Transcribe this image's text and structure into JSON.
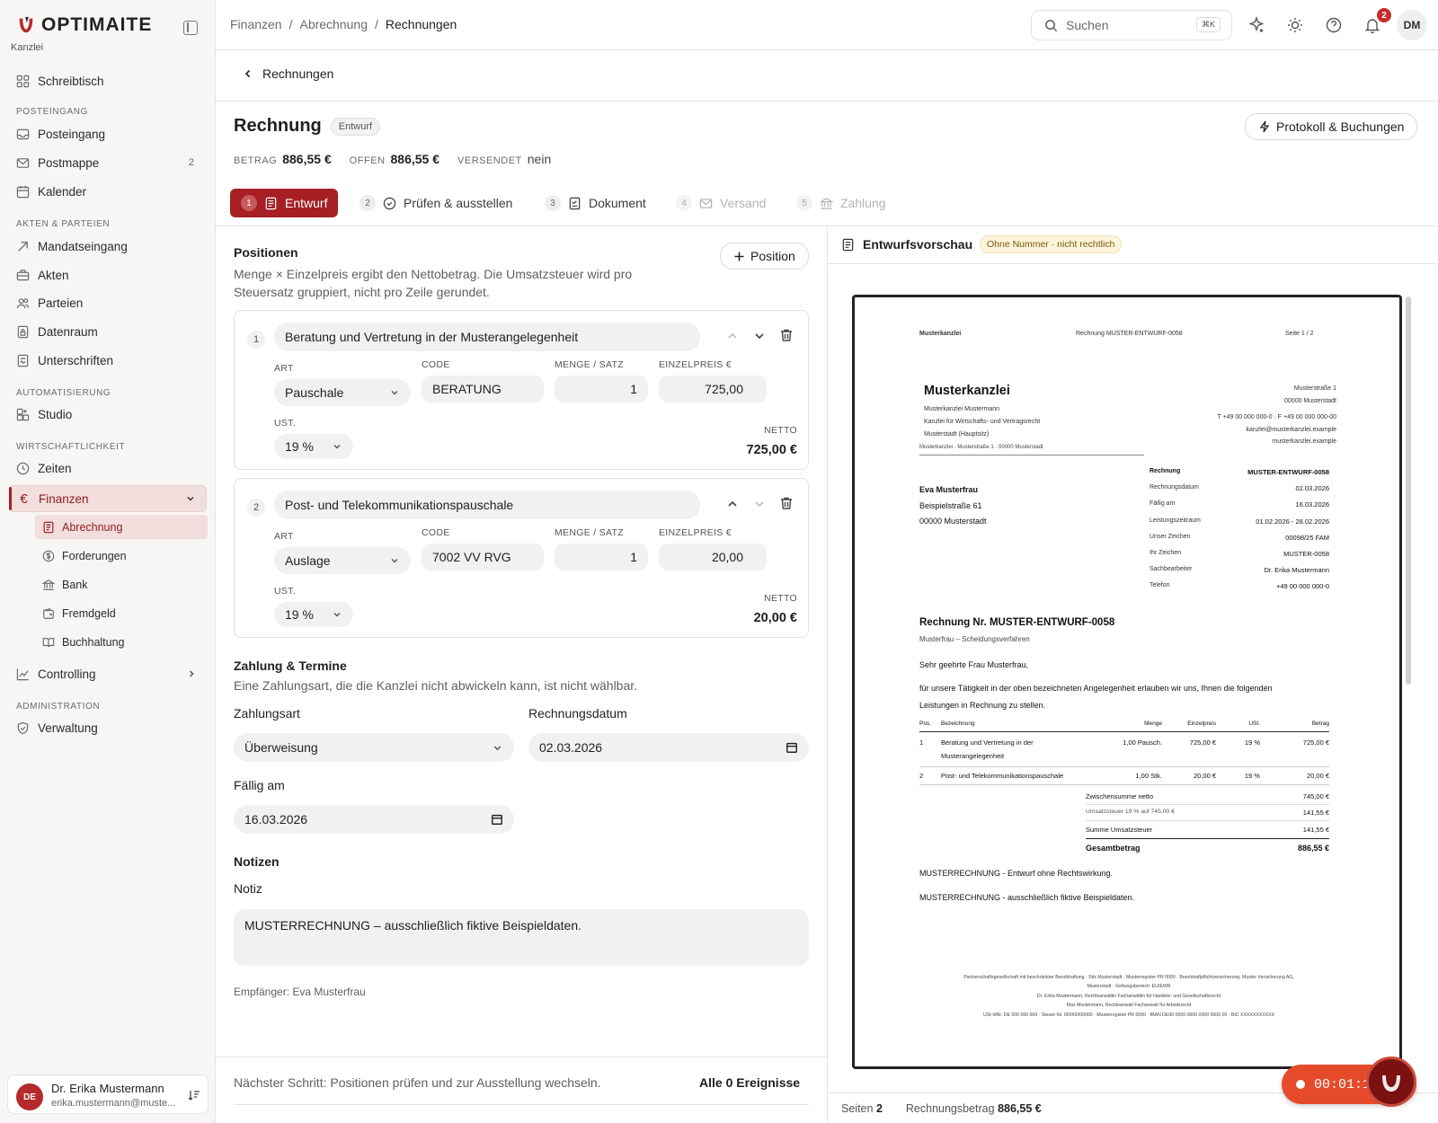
{
  "app": {
    "logo": "OPTIMAITE",
    "workspace": "Kanzlei"
  },
  "sidebar": {
    "items_top": [
      {
        "label": "Schreibtisch"
      }
    ],
    "sections": [
      {
        "title": "POSTEINGANG",
        "items": [
          {
            "label": "Posteingang"
          },
          {
            "label": "Postmappe",
            "count": "2"
          },
          {
            "label": "Kalender"
          }
        ]
      },
      {
        "title": "AKTEN & PARTEIEN",
        "items": [
          {
            "label": "Mandatseingang"
          },
          {
            "label": "Akten"
          },
          {
            "label": "Parteien"
          },
          {
            "label": "Datenraum"
          },
          {
            "label": "Unterschriften"
          }
        ]
      },
      {
        "title": "AUTOMATISIERUNG",
        "items": [
          {
            "label": "Studio"
          }
        ]
      },
      {
        "title": "WIRTSCHAFTLICHKEIT",
        "items": [
          {
            "label": "Zeiten"
          },
          {
            "label": "Finanzen"
          }
        ]
      },
      {
        "title": "ADMINISTRATION",
        "items": [
          {
            "label": "Verwaltung"
          }
        ]
      }
    ],
    "finanzen_sub": [
      {
        "label": "Abrechnung"
      },
      {
        "label": "Forderungen"
      },
      {
        "label": "Bank"
      },
      {
        "label": "Fremdgeld"
      },
      {
        "label": "Buchhaltung"
      }
    ],
    "controlling": "Controlling",
    "user": {
      "initials": "DE",
      "name": "Dr. Erika Mustermann",
      "email": "erika.mustermann@muste..."
    }
  },
  "topbar": {
    "breadcrumbs": [
      "Finanzen",
      "Abrechnung",
      "Rechnungen"
    ],
    "search_placeholder": "Suchen",
    "search_shortcut": "⌘K",
    "notifications_count": "2",
    "avatar": "DM"
  },
  "page": {
    "back_label": "Rechnungen",
    "title": "Rechnung",
    "status": "Entwurf",
    "protocol_button": "Protokoll & Buchungen",
    "summary": {
      "betrag_label": "BETRAG",
      "betrag": "886,55 €",
      "offen_label": "OFFEN",
      "offen": "886,55 €",
      "versendet_label": "VERSENDET",
      "versendet": "nein"
    },
    "steps": [
      {
        "n": "1",
        "label": "Entwurf"
      },
      {
        "n": "2",
        "label": "Prüfen & ausstellen"
      },
      {
        "n": "3",
        "label": "Dokument"
      },
      {
        "n": "4",
        "label": "Versand"
      },
      {
        "n": "5",
        "label": "Zahlung"
      }
    ]
  },
  "positions": {
    "title": "Positionen",
    "add_button": "Position",
    "description": "Menge × Einzelpreis ergibt den Nettobetrag. Die Umsatzsteuer wird pro Steuersatz gruppiert, nicht pro Zeile gerundet.",
    "description_line1": "Menge × Einzelpreis ergibt den Nettobetrag. Die Umsatzsteuer wird pro",
    "description_line2": "Steuersatz gruppiert, nicht pro Zeile gerundet.",
    "labels": {
      "art": "ART",
      "code": "CODE",
      "menge": "MENGE / SATZ",
      "einzelpreis": "EINZELPREIS €",
      "ust": "UST.",
      "netto": "NETTO"
    },
    "items": [
      {
        "n": "1",
        "title": "Beratung und Vertretung in der Musterangelegenheit",
        "art": "Pauschale",
        "code": "BERATUNG",
        "menge": "1",
        "einzelpreis": "725,00",
        "ust": "19 %",
        "netto": "725,00 €"
      },
      {
        "n": "2",
        "title": "Post- und Telekommunikationspauschale",
        "art": "Auslage",
        "code": "7002 VV RVG",
        "menge": "1",
        "einzelpreis": "20,00",
        "ust": "19 %",
        "netto": "20,00 €"
      }
    ]
  },
  "payment": {
    "title": "Zahlung & Termine",
    "description": "Eine Zahlungsart, die die Kanzlei nicht abwickeln kann, ist nicht wählbar.",
    "zahlungsart_label": "Zahlungsart",
    "zahlungsart": "Überweisung",
    "rechnungsdatum_label": "Rechnungsdatum",
    "rechnungsdatum": "02.03.2026",
    "faellig_label": "Fällig am",
    "faellig": "16.03.2026"
  },
  "notes": {
    "title": "Notizen",
    "label": "Notiz",
    "value": "MUSTERRECHNUNG – ausschließlich fiktive Beispieldaten.",
    "recipient": "Empfänger: Eva Musterfrau"
  },
  "footer": {
    "next_step": "Nächster Schritt: Positionen prüfen und zur Ausstellung wechseln.",
    "events": "Alle 0 Ereignisse"
  },
  "preview": {
    "title": "Entwurfsvorschau",
    "warning": "Ohne Nummer · nicht rechtlich",
    "footer_pages_label": "Seiten",
    "footer_pages": "2",
    "footer_amount_label": "Rechnungsbetrag",
    "footer_amount": "886,55 €",
    "timer": "00:01:14",
    "doc": {
      "head_left": "Musterkanzlei",
      "head_center": "Rechnung MUSTER-ENTWURF-0058",
      "head_right": "Seite 1   / 2",
      "firm": "Musterkanzlei",
      "firm_lines": [
        "Musterkanzlei Mustermann",
        "Kanzlei für Wirtschafts- und Vertragsrecht",
        "Musterstadt (Hauptsitz)"
      ],
      "address_right": [
        "Musterstraße 1",
        "00000 Musterstadt",
        "",
        "T +49 00 000 000-0 · F +49 00 000 000-00",
        "kanzlei@musterkanzlei.example",
        "musterkanzlei.example"
      ],
      "sender_line": "Musterkanzlei · Musterstraße 1 · 00000 Musterstadt",
      "recipient": [
        "Eva Musterfrau",
        "Beispielstraße 61",
        "00000 Musterstadt"
      ],
      "meta": [
        {
          "k": "Rechnung",
          "v": "MUSTER-ENTWURF-0058"
        },
        {
          "k": "Rechnungsdatum",
          "v": "02.03.2026"
        },
        {
          "k": "Fällig am",
          "v": "16.03.2026"
        },
        {
          "k": "Leistungszeitraum",
          "v": "01.02.2026 - 28.02.2026"
        },
        {
          "k": "Unser Zeichen",
          "v": "00098/25 FAM"
        },
        {
          "k": "Ihr Zeichen",
          "v": "MUSTER-0058"
        },
        {
          "k": "Sachbearbeiter",
          "v": "Dr. Erika Mustermann"
        },
        {
          "k": "Telefon",
          "v": "+49 00 000 000-0"
        }
      ],
      "invoice_title": "Rechnung Nr. MUSTER-ENTWURF-0058",
      "subject": "Musterfrau – Scheidungsverfahren",
      "salutation": "Sehr geehrte Frau Musterfrau,",
      "intro1": "für unsere Tätigkeit in der oben bezeichneten Angelegenheit erlauben wir uns, Ihnen die folgenden",
      "intro2": "Leistungen in Rechnung zu stellen.",
      "table_head": [
        "Pos.",
        "Bezeichnung",
        "Menge",
        "Einzelpreis",
        "USt.",
        "Betrag"
      ],
      "rows": [
        {
          "pos": "1",
          "bez1": "Beratung und Vertretung in der",
          "bez2": "Musterangelegenheit",
          "menge": "1,00 Pausch.",
          "ep": "725,00 €",
          "ust": "19 %",
          "betrag": "725,00 €"
        },
        {
          "pos": "2",
          "bez1": "Post- und Telekommunikationspauschale",
          "bez2": "",
          "menge": "1,00 Stk.",
          "ep": "20,00 €",
          "ust": "19 %",
          "betrag": "20,00 €"
        }
      ],
      "totals": [
        {
          "k": "Zwischensumme netto",
          "v": "745,00 €"
        },
        {
          "k": "Umsatzsteuer 19 % auf 745,00 €",
          "v": "141,55 €"
        },
        {
          "k": "Summe Umsatzsteuer",
          "v": "141,55 €"
        }
      ],
      "grand_label": "Gesamtbetrag",
      "grand": "886,55 €",
      "note1": "MUSTERRECHNUNG - Entwurf ohne Rechtswirkung.",
      "note2": "MUSTERRECHNUNG - ausschließlich fiktive Beispieldaten.",
      "footer_lines": [
        "Partnerschaftsgesellschaft mit beschränkter Berufshaftung · Sitz Musterstadt · Musterregister PR 0000 · Berufshaftpflichtversicherung: Muster Versicherung AG,",
        "Musterstadt · Geltungsbereich: EU/EWR",
        "Dr. Erika Mustermann, Rechtsanwältin Fachanwältin für Handels- und Gesellschaftsrecht",
        "Max Mustermann, Rechtsanwalt Fachanwalt für Arbeitsrecht",
        "USt-IdNr. DE 000 000 000 · Steuer-Nr. 00/000/00000 · Musterregister PR 0000 · IBAN DE00 0000 0000 0000 0000 00 · BIC XXXXXXXXXXX"
      ]
    }
  }
}
